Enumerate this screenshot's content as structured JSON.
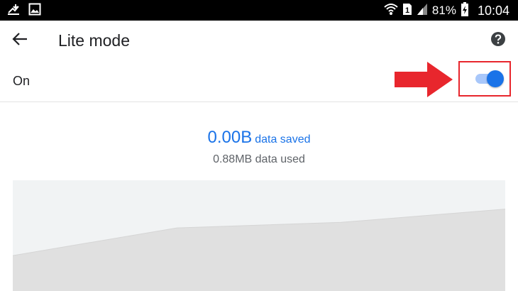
{
  "status_bar": {
    "battery_percent": "81%",
    "time": "10:04",
    "sim_slot": "1",
    "icons": [
      "usb-download-icon",
      "image-icon",
      "wifi-icon",
      "sim-card-icon",
      "signal-icon",
      "battery-charging-icon"
    ]
  },
  "toolbar": {
    "title": "Lite mode",
    "back_icon": "arrow-back-icon",
    "help_icon": "help-circle-icon"
  },
  "toggle_row": {
    "label": "On",
    "state": "on",
    "annotation": "red-arrow-and-box-highlighting-toggle"
  },
  "summary": {
    "saved_amount": "0.00B",
    "saved_label": "data saved",
    "used_text": "0.88MB data used"
  },
  "colors": {
    "accent": "#1a73e8",
    "toggle_track": "#a8c7fa",
    "annotation_red": "#e8262d",
    "chart_background": "#f1f3f4",
    "chart_area": "#e0e0e0"
  },
  "chart_data": {
    "type": "area",
    "title": "",
    "xlabel": "",
    "ylabel": "",
    "ylim": [
      0,
      1
    ],
    "series": [
      {
        "values": [
          0.32,
          0.57,
          0.62,
          0.74
        ]
      }
    ]
  }
}
